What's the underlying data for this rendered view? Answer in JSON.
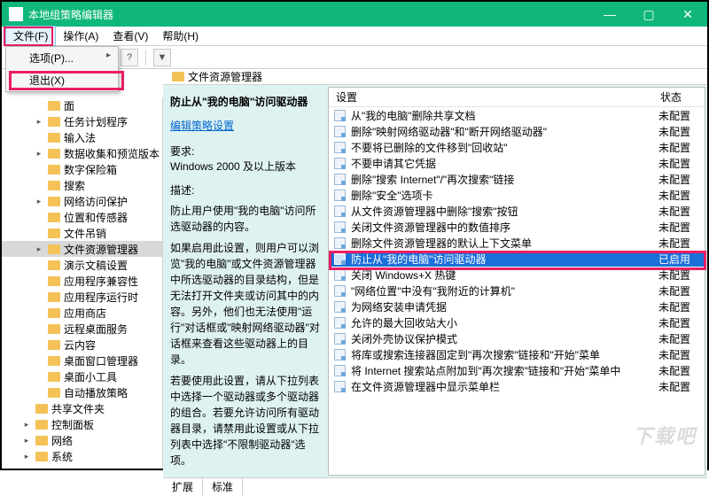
{
  "window": {
    "title": "本地组策略编辑器"
  },
  "menubar": {
    "file": "文件(F)",
    "action": "操作(A)",
    "view": "查看(V)",
    "help": "帮助(H)"
  },
  "dropdown": {
    "options": "选项(P)...",
    "exit": "退出(X)"
  },
  "address": {
    "crumb": "文件资源管理器"
  },
  "tree": [
    {
      "indent": 0,
      "exp": "",
      "label": "面",
      "sel": false
    },
    {
      "indent": 0,
      "exp": "▸",
      "label": "任务计划程序",
      "sel": false
    },
    {
      "indent": 0,
      "exp": "",
      "label": "输入法",
      "sel": false
    },
    {
      "indent": 0,
      "exp": "▸",
      "label": "数据收集和预览版本",
      "sel": false
    },
    {
      "indent": 0,
      "exp": "",
      "label": "数字保险箱",
      "sel": false
    },
    {
      "indent": 0,
      "exp": "",
      "label": "搜索",
      "sel": false
    },
    {
      "indent": 0,
      "exp": "▸",
      "label": "网络访问保护",
      "sel": false
    },
    {
      "indent": 0,
      "exp": "",
      "label": "位置和传感器",
      "sel": false
    },
    {
      "indent": 0,
      "exp": "",
      "label": "文件吊销",
      "sel": false
    },
    {
      "indent": 0,
      "exp": "▸",
      "label": "文件资源管理器",
      "sel": true
    },
    {
      "indent": 0,
      "exp": "",
      "label": "演示文稿设置",
      "sel": false
    },
    {
      "indent": 0,
      "exp": "",
      "label": "应用程序兼容性",
      "sel": false
    },
    {
      "indent": 0,
      "exp": "",
      "label": "应用程序运行时",
      "sel": false
    },
    {
      "indent": 0,
      "exp": "",
      "label": "应用商店",
      "sel": false
    },
    {
      "indent": 0,
      "exp": "",
      "label": "远程桌面服务",
      "sel": false
    },
    {
      "indent": 0,
      "exp": "",
      "label": "云内容",
      "sel": false
    },
    {
      "indent": 0,
      "exp": "",
      "label": "桌面窗口管理器",
      "sel": false
    },
    {
      "indent": 0,
      "exp": "",
      "label": "桌面小工具",
      "sel": false
    },
    {
      "indent": 0,
      "exp": "",
      "label": "自动播放策略",
      "sel": false
    },
    {
      "indent": -1,
      "exp": "",
      "label": "共享文件夹",
      "sel": false
    },
    {
      "indent": -1,
      "exp": "▸",
      "label": "控制面板",
      "sel": false
    },
    {
      "indent": -1,
      "exp": "▸",
      "label": "网络",
      "sel": false
    },
    {
      "indent": -1,
      "exp": "▸",
      "label": "系统",
      "sel": false
    }
  ],
  "desc": {
    "title": "防止从\"我的电脑\"访问驱动器",
    "edit_link": "编辑策略设置",
    "req_label": "要求:",
    "req_value": "Windows 2000 及以上版本",
    "desc_label": "描述:",
    "p1": "防止用户使用\"我的电脑\"访问所选驱动器的内容。",
    "p2": "如果启用此设置，则用户可以浏览\"我的电脑\"或文件资源管理器中所选驱动器的目录结构，但是无法打开文件夹或访问其中的内容。另外，他们也无法使用\"运行\"对话框或\"映射网络驱动器\"对话框来查看这些驱动器上的目录。",
    "p3": "若要使用此设置，请从下拉列表中选择一个驱动器或多个驱动器的组合。若要允许访问所有驱动器目录，请禁用此设置或从下拉列表中选择\"不限制驱动器\"选项。"
  },
  "list": {
    "head_setting": "设置",
    "head_state": "状态",
    "rows": [
      {
        "label": "从\"我的电脑\"删除共享文档",
        "state": "未配置"
      },
      {
        "label": "删除\"映射网络驱动器\"和\"断开网络驱动器\"",
        "state": "未配置"
      },
      {
        "label": "不要将已删除的文件移到\"回收站\"",
        "state": "未配置"
      },
      {
        "label": "不要申请其它凭据",
        "state": "未配置"
      },
      {
        "label": "删除\"搜索 Internet\"/\"再次搜索\"链接",
        "state": "未配置"
      },
      {
        "label": "删除\"安全\"选项卡",
        "state": "未配置"
      },
      {
        "label": "从文件资源管理器中删除\"搜索\"按钮",
        "state": "未配置"
      },
      {
        "label": "关闭文件资源管理器中的数值排序",
        "state": "未配置"
      },
      {
        "label": "删除文件资源管理器的默认上下文菜单",
        "state": "未配置"
      },
      {
        "label": "防止从\"我的电脑\"访问驱动器",
        "state": "已启用",
        "selected": true
      },
      {
        "label": "关闭 Windows+X 热键",
        "state": "未配置"
      },
      {
        "label": "\"网络位置\"中没有\"我附近的计算机\"",
        "state": "未配置"
      },
      {
        "label": "为网络安装申请凭据",
        "state": "未配置"
      },
      {
        "label": "允许的最大回收站大小",
        "state": "未配置"
      },
      {
        "label": "关闭外壳协议保护模式",
        "state": "未配置"
      },
      {
        "label": "将库或搜索连接器固定到\"再次搜索\"链接和\"开始\"菜单",
        "state": "未配置"
      },
      {
        "label": "将 Internet 搜索站点附加到\"再次搜索\"链接和\"开始\"菜单中",
        "state": "未配置"
      },
      {
        "label": "在文件资源管理器中显示菜单栏",
        "state": "未配置"
      }
    ]
  },
  "tabs": {
    "extended": "扩展",
    "standard": "标准"
  },
  "watermark": "下载吧"
}
